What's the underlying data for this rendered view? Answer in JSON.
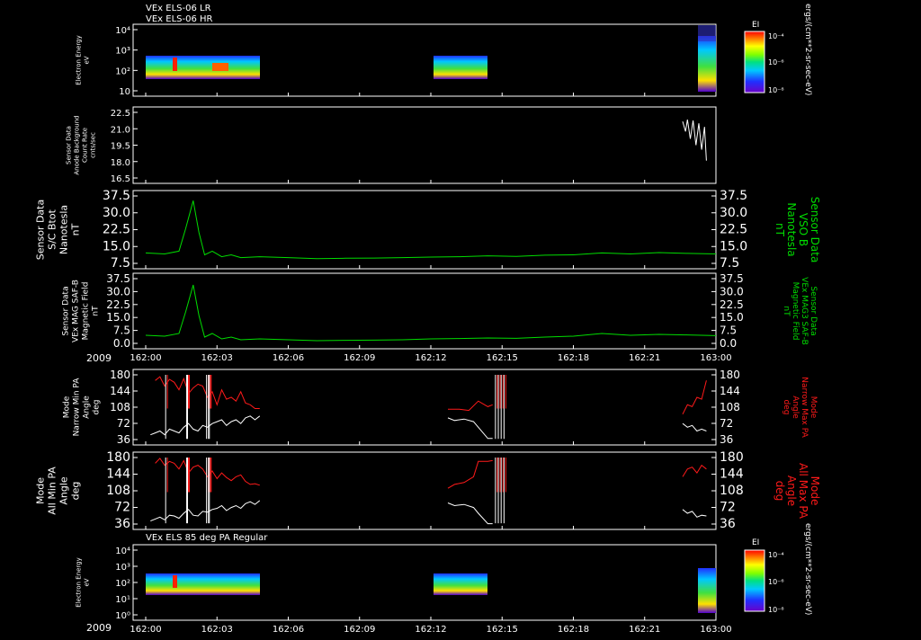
{
  "figure": {
    "header_lines": [
      "VEx ELS-06 LR",
      "VEx ELS-06 HR"
    ],
    "bottom_panel_title": "VEx ELS 85 deg PA Regular",
    "year_label": "2009",
    "time_ticks": [
      "162:00",
      "162:03",
      "162:06",
      "162:09",
      "162:12",
      "162:15",
      "162:18",
      "162:21",
      "163:00"
    ]
  },
  "colors": {
    "background": "#000000",
    "axes": "#ffffff",
    "green_series": "#00dd00",
    "red_series": "#ff1a1a",
    "white_series": "#ffffff"
  },
  "chart_data": [
    {
      "type": "heatmap",
      "name": "Electron energy spectrogram (LR/HR)",
      "ylabel": [
        "Electron Energy",
        "eV"
      ],
      "yticks": [
        "10⁴",
        "10³",
        "10²",
        "10"
      ],
      "ylim": [
        3,
        20000
      ],
      "y_scale": "log",
      "data_intervals_minutes": [
        [
          0,
          12.2
        ],
        [
          31.8,
          37.8
        ],
        [
          56.3,
          58.7
        ]
      ],
      "colorbar": {
        "label": "EI",
        "ticks": [
          "10⁻⁴",
          "10⁻⁶",
          "10⁻⁸"
        ],
        "unit": "ergs/(cm**2-sr-sec-eV)"
      }
    },
    {
      "type": "line",
      "name": "Sensor Data Anode Background",
      "ylabel": [
        "Sensor Data",
        "Anode Background",
        "Count Rate",
        "cnts/sec"
      ],
      "yticks": [
        "22.5",
        "21.0",
        "19.5",
        "18.0",
        "16.5"
      ],
      "ylim": [
        15.0,
        22.5
      ],
      "series": [
        {
          "color": "white",
          "x": [
            56.5,
            56.8,
            57.0,
            57.3,
            57.6,
            57.9,
            58.2,
            58.5,
            58.8,
            59.0
          ],
          "y": [
            21.5,
            20.4,
            21.7,
            19.6,
            21.6,
            18.9,
            21.3,
            18.4,
            20.9,
            17.2
          ]
        }
      ]
    },
    {
      "type": "line",
      "name": "S/C Btot",
      "ylabel": [
        "Sensor Data",
        "S/C Btot",
        "Nanotesla",
        "nT"
      ],
      "right_label": [
        "Sensor Data",
        "VSO B",
        "Nanotesla",
        "nT"
      ],
      "yticks": [
        "37.5",
        "30.0",
        "22.5",
        "15.0",
        "7.5"
      ],
      "ylim": [
        0,
        37.5
      ],
      "series": [
        {
          "color": "green",
          "x": [
            0,
            2,
            3.5,
            4.2,
            5.0,
            5.6,
            6.2,
            7,
            8,
            9,
            10,
            12,
            15,
            18,
            21,
            24,
            27,
            30,
            33,
            36,
            39,
            42,
            45,
            48,
            51,
            54,
            57,
            60
          ],
          "y": [
            7,
            6.5,
            8,
            20,
            35,
            18,
            6,
            8,
            5,
            6,
            4.5,
            5,
            4.5,
            4,
            4.2,
            4.3,
            4.5,
            4.8,
            5,
            5.5,
            5.2,
            5.8,
            6,
            7,
            6.5,
            7.2,
            6.8,
            6.5
          ]
        }
      ]
    },
    {
      "type": "line",
      "name": "VEx MAG SAF-B Magnetic Field",
      "ylabel": [
        "Sensor Data",
        "VEx MAG SAF-B",
        "Magnetic Field",
        "nT"
      ],
      "right_label": [
        "Sensor Data",
        "VEx MAG3 SAF-B",
        "Magnetic Field",
        "nT"
      ],
      "yticks": [
        "37.5",
        "30.0",
        "22.5",
        "15.0",
        "7.5",
        "0.0"
      ],
      "ylim": [
        0,
        37.5
      ],
      "series": [
        {
          "color": "green",
          "x": [
            0,
            2,
            3.5,
            4.2,
            5.0,
            5.6,
            6.2,
            7,
            8,
            9,
            10,
            12,
            15,
            18,
            21,
            24,
            27,
            30,
            33,
            36,
            39,
            42,
            45,
            48,
            51,
            54,
            57,
            60
          ],
          "y": [
            6,
            5.5,
            7,
            19,
            34,
            17,
            5,
            7,
            4,
            5,
            3.5,
            4,
            3.5,
            3,
            3.2,
            3.3,
            3.5,
            4,
            4.2,
            4.5,
            4.3,
            5,
            5.5,
            7,
            6,
            6.5,
            6.2,
            5.8
          ]
        }
      ]
    },
    {
      "type": "line",
      "name": "Narrow Min/Max PA",
      "ylabel": [
        "Mode",
        "Narrow Min PA",
        "Angle",
        "deg"
      ],
      "right_label": [
        "Mode",
        "Narrow Max PA",
        "Angle",
        "deg"
      ],
      "yticks": [
        "180",
        "144",
        "108",
        "72",
        "36"
      ],
      "ylim": [
        0,
        180
      ],
      "series": [
        {
          "color": "red",
          "segments": [
            {
              "x": [
                1.0,
                1.5,
                2.0,
                2.5,
                3.0,
                3.5,
                4.0,
                4.5,
                5.0,
                5.5,
                6.0,
                6.5,
                7.0,
                7.5,
                8.0,
                8.5,
                9.0,
                9.5,
                10.0,
                10.5,
                11.0,
                11.5,
                12.0
              ],
              "y": [
                165,
                175,
                150,
                168,
                160,
                140,
                170,
                130,
                145,
                155,
                150,
                120,
                135,
                100,
                140,
                115,
                120,
                110,
                135,
                105,
                100,
                90,
                90
              ]
            },
            {
              "x": [
                31.8,
                33,
                34,
                35,
                36,
                36.5
              ],
              "y": [
                88,
                88,
                85,
                110,
                95,
                100
              ]
            },
            {
              "x": [
                56.5,
                57,
                57.5,
                58,
                58.5,
                59
              ],
              "y": [
                75,
                100,
                95,
                120,
                115,
                165
              ]
            }
          ]
        },
        {
          "color": "white",
          "segments": [
            {
              "x": [
                0.5,
                1.0,
                1.5,
                2.0,
                2.5,
                3.0,
                3.5,
                4.0,
                4.5,
                5.0,
                5.5,
                6.0,
                6.5,
                7.0,
                7.5,
                8.0,
                8.5,
                9.0,
                9.5,
                10.0,
                10.5,
                11.0,
                11.5,
                12.0
              ],
              "y": [
                20,
                25,
                30,
                20,
                35,
                30,
                25,
                40,
                50,
                35,
                30,
                45,
                40,
                50,
                55,
                60,
                45,
                55,
                60,
                50,
                65,
                70,
                60,
                70
              ]
            },
            {
              "x": [
                31.8,
                32.5,
                33.5,
                34.5,
                35,
                36,
                36.5
              ],
              "y": [
                65,
                58,
                62,
                55,
                40,
                10,
                10
              ]
            },
            {
              "x": [
                56.5,
                57,
                57.5,
                58,
                58.5,
                59
              ],
              "y": [
                50,
                40,
                45,
                30,
                35,
                30
              ]
            }
          ]
        }
      ],
      "spikes_x": [
        2.1,
        4.3,
        4.4,
        6.4,
        6.6,
        6.7,
        36.8,
        37.1,
        37.4,
        37.7
      ]
    },
    {
      "type": "line",
      "name": "All Min/Max PA",
      "ylabel": [
        "Mode",
        "All Min PA",
        "Angle",
        "deg"
      ],
      "right_label": [
        "Mode",
        "All Max PA",
        "Angle",
        "deg"
      ],
      "yticks": [
        "180",
        "144",
        "108",
        "72",
        "36"
      ],
      "ylim": [
        0,
        180
      ],
      "series": [
        {
          "color": "red",
          "segments": [
            {
              "x": [
                1.0,
                1.5,
                2.0,
                2.5,
                3.0,
                3.5,
                4.0,
                4.5,
                5.0,
                5.5,
                6.0,
                6.5,
                7.0,
                7.5,
                8.0,
                8.5,
                9.0,
                9.5,
                10.0,
                10.5,
                11.0,
                11.5,
                12.0
              ],
              "y": [
                165,
                178,
                160,
                170,
                165,
                150,
                172,
                140,
                155,
                160,
                150,
                130,
                145,
                125,
                140,
                128,
                120,
                130,
                135,
                118,
                110,
                112,
                108
              ]
            },
            {
              "x": [
                31.8,
                32.5,
                33.5,
                34.5,
                35,
                36,
                36.5
              ],
              "y": [
                100,
                110,
                115,
                130,
                170,
                170,
                172
              ]
            },
            {
              "x": [
                56.5,
                57,
                57.5,
                58,
                58.5,
                59
              ],
              "y": [
                130,
                150,
                155,
                140,
                160,
                150
              ]
            }
          ]
        },
        {
          "color": "white",
          "segments": [
            {
              "x": [
                0.5,
                1.0,
                1.5,
                2.0,
                2.5,
                3.0,
                3.5,
                4.0,
                4.5,
                5.0,
                5.5,
                6.0,
                6.5,
                7.0,
                7.5,
                8.0,
                8.5,
                9.0,
                9.5,
                10.0,
                10.5,
                11.0,
                11.5,
                12.0
              ],
              "y": [
                15,
                20,
                25,
                18,
                30,
                28,
                22,
                35,
                45,
                30,
                28,
                40,
                38,
                45,
                48,
                55,
                42,
                50,
                55,
                48,
                60,
                65,
                58,
                68
              ]
            },
            {
              "x": [
                31.8,
                32.5,
                33.5,
                34.5,
                35,
                36,
                36.5
              ],
              "y": [
                62,
                55,
                58,
                50,
                35,
                8,
                8
              ]
            },
            {
              "x": [
                56.5,
                57,
                57.5,
                58,
                58.5,
                59
              ],
              "y": [
                45,
                35,
                40,
                25,
                30,
                28
              ]
            }
          ]
        }
      ],
      "spikes_x": [
        2.1,
        4.3,
        4.4,
        6.4,
        6.6,
        6.7,
        36.8,
        37.1,
        37.4,
        37.7
      ]
    },
    {
      "type": "heatmap",
      "name": "Electron energy spectrogram 85 deg PA",
      "ylabel": [
        "Electron Energy",
        "eV"
      ],
      "yticks": [
        "10⁴",
        "10³",
        "10²",
        "10¹",
        "10⁰"
      ],
      "ylim": [
        1,
        20000
      ],
      "y_scale": "log",
      "data_intervals_minutes": [
        [
          0,
          12.2
        ],
        [
          31.8,
          37.8
        ],
        [
          56.3,
          58.7
        ]
      ],
      "colorbar": {
        "label": "EI",
        "ticks": [
          "10⁻⁴",
          "10⁻⁶",
          "10⁻⁸"
        ],
        "unit": "ergs/(cm**2-sr-sec-eV)"
      }
    }
  ]
}
